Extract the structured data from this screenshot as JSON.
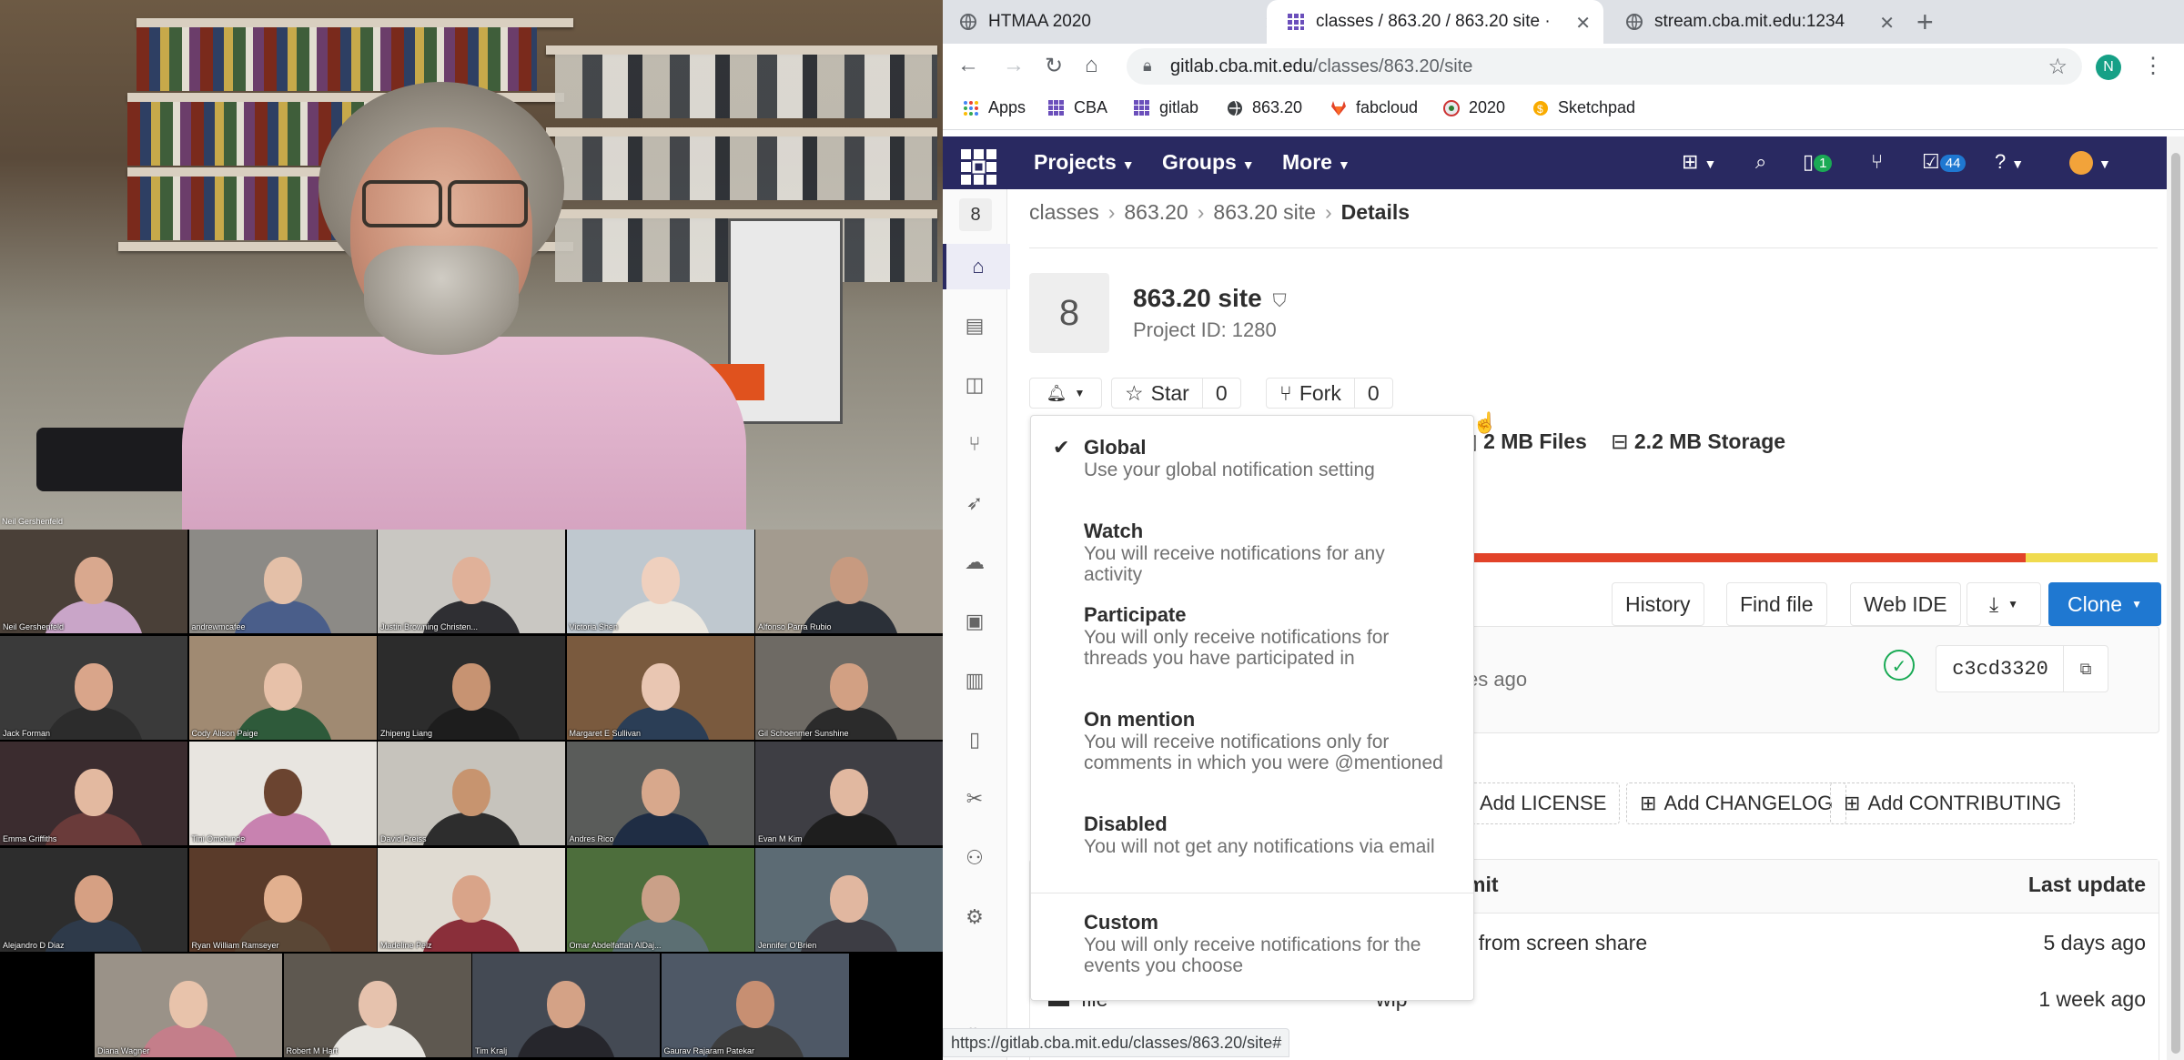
{
  "video": {
    "speaker_label": "Neil Gershenfeld",
    "participants": [
      "Neil Gershenfeld",
      "andrewmcafee",
      "Justin Browning Christen...",
      "Victoria Shen",
      "Alfonso Parra Rubio",
      "Jack Forman",
      "Cody Alison Paige",
      "Zhipeng Liang",
      "Margaret E Sullivan",
      "Gil Schoenmer Sunshine",
      "Emma Griffiths",
      "Tini Omotunde",
      "David Preiss",
      "Andres Rico",
      "Evan M Kim",
      "Alejandro D Diaz",
      "Ryan William Ramseyer",
      "Madeline Pelz",
      "Omar Abdelfattah AlDaj...",
      "Jennifer O'Brien",
      "Diana Wagner",
      "Robert M Hart",
      "Tim Kralj",
      "Gaurav Rajaram Patekar"
    ]
  },
  "browser": {
    "tabs": [
      {
        "label": "HTMAA 2020",
        "active": false
      },
      {
        "label": "classes / 863.20 / 863.20 site ·",
        "active": true
      },
      {
        "label": "stream.cba.mit.edu:1234",
        "active": false
      }
    ],
    "url_host": "gitlab.cba.mit.edu",
    "url_path": "/classes/863.20/site",
    "profile_initial": "N",
    "bookmarks": [
      "Apps",
      "CBA",
      "gitlab",
      "863.20",
      "fabcloud",
      "2020",
      "Sketchpad"
    ],
    "status_url": "https://gitlab.cba.mit.edu/classes/863.20/site#"
  },
  "gitlab": {
    "nav": {
      "projects": "Projects",
      "groups": "Groups",
      "more": "More",
      "mr_count": "1",
      "todo_count": "44"
    },
    "sidebar_avatar": "8",
    "breadcrumb": [
      "classes",
      "863.20",
      "863.20 site",
      "Details"
    ],
    "project": {
      "avatar_letter": "8",
      "name": "863.20 site",
      "id_text": "Project ID: 1280",
      "star_label": "Star",
      "star_count": "0",
      "fork_label": "Fork",
      "fork_count": "0",
      "files_stat": "2 MB Files",
      "storage_stat": "2.2 MB Storage"
    },
    "actions": {
      "history": "History",
      "find_file": "Find file",
      "web_ide": "Web IDE",
      "clone": "Clone"
    },
    "commit": {
      "time_fragment": "es ago",
      "sha": "c3cd3320"
    },
    "add_buttons": [
      "Add LICENSE",
      "Add CHANGELOG",
      "Add CONTRIBUTING"
    ],
    "file_table": {
      "headers": {
        "commit": "mit",
        "last_update": "Last update"
      },
      "rows": [
        {
          "name": "",
          "commit": "t from screen share",
          "updated": "5 days ago"
        },
        {
          "name": "file",
          "commit": "wip",
          "updated": "1 week ago"
        }
      ]
    },
    "notifications_dropdown": [
      {
        "title": "Global",
        "desc": "Use your global notification setting",
        "checked": true
      },
      {
        "title": "Watch",
        "desc": "You will receive notifications for any activity",
        "checked": false
      },
      {
        "title": "Participate",
        "desc": "You will only receive notifications for threads you have participated in",
        "checked": false
      },
      {
        "title": "On mention",
        "desc": "You will receive notifications only for comments in which you were @mentioned",
        "checked": false
      },
      {
        "title": "Disabled",
        "desc": "You will not get any notifications via email",
        "checked": false
      },
      {
        "title": "Custom",
        "desc": "You will only receive notifications for the events you choose",
        "checked": false
      }
    ],
    "colors": {
      "navbar": "#292961",
      "primary": "#1f78d1",
      "lang_a": "#e24329",
      "lang_b": "#f0db4f",
      "success": "#1aaa55"
    }
  }
}
